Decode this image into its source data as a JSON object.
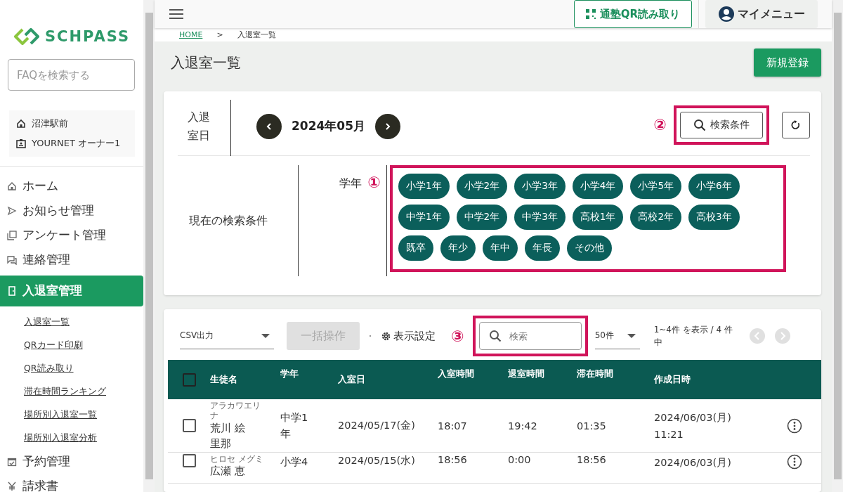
{
  "sidebar": {
    "logo": "SCHPASS",
    "faq_search": {
      "placeholder": "FAQを検索する"
    },
    "school": "沼津駅前",
    "user": "YOURNET オーナー1",
    "menu": [
      {
        "label": "ホーム",
        "selected": false
      },
      {
        "label": "お知らせ管理",
        "selected": false
      },
      {
        "label": "アンケート管理",
        "selected": false
      },
      {
        "label": "連絡管理",
        "selected": false
      },
      {
        "label": "入退室管理",
        "selected": true,
        "children": [
          {
            "label": "入退室一覧"
          },
          {
            "label": "QRカード印刷"
          },
          {
            "label": "QR読み取り"
          },
          {
            "label": "滞在時間ランキング"
          },
          {
            "label": "場所別入退室一覧"
          },
          {
            "label": "場所別入退室分析"
          }
        ]
      },
      {
        "label": "予約管理",
        "selected": false
      },
      {
        "label": "請求書",
        "selected": false
      }
    ]
  },
  "header": {
    "qr_button": "通塾QR読み取り",
    "my_menu": "マイメニュー"
  },
  "breadcrumb": [
    "HOME",
    ">",
    "入退室一覧"
  ],
  "page_title": "入退室一覧",
  "new_button": "新規登録",
  "filter": {
    "date_label": "入退室日",
    "month": "2024年05月",
    "search_marker": "②",
    "search_button": "検索条件",
    "current_label": "現在の検索条件",
    "grade_label": "学年",
    "grade_marker": "①",
    "grades": [
      "小学1年",
      "小学2年",
      "小学3年",
      "小学4年",
      "小学5年",
      "小学6年",
      "中学1年",
      "中学2年",
      "中学3年",
      "高校1年",
      "高校2年",
      "高校3年",
      "既卒",
      "年少",
      "年中",
      "年長",
      "その他"
    ]
  },
  "toolbar": {
    "csv": "CSV出力",
    "bulk": {
      "label": "一括操作",
      "disabled": true
    },
    "display_settings": "表示設定",
    "search_marker": "③",
    "search": {
      "placeholder": "検索"
    },
    "per_page": "50件",
    "range": "1~4件 を表示 / 4 件中"
  },
  "table": {
    "select_all_checked": false,
    "columns": [
      "生徒名",
      "学年",
      "入室日",
      "入室時間",
      "退室時間",
      "滞在時間",
      "作成日時"
    ],
    "rows": [
      {
        "checked": false,
        "kana": "アラカワエリナ",
        "name": "荒川 絵里那",
        "grade": "中学1年",
        "date": "2024/05/17(金)",
        "in": "18:07",
        "out": "19:42",
        "stay": "01:35",
        "created": "2024/06/03(月) 11:21"
      },
      {
        "checked": false,
        "kana": "ヒロセ メグミ",
        "name": "広瀬 恵",
        "grade": "小学4",
        "date": "2024/05/15(水)",
        "in": "18:56",
        "out": "0:00",
        "stay": "18:56",
        "created": "2024/06/03(月)"
      }
    ]
  }
}
